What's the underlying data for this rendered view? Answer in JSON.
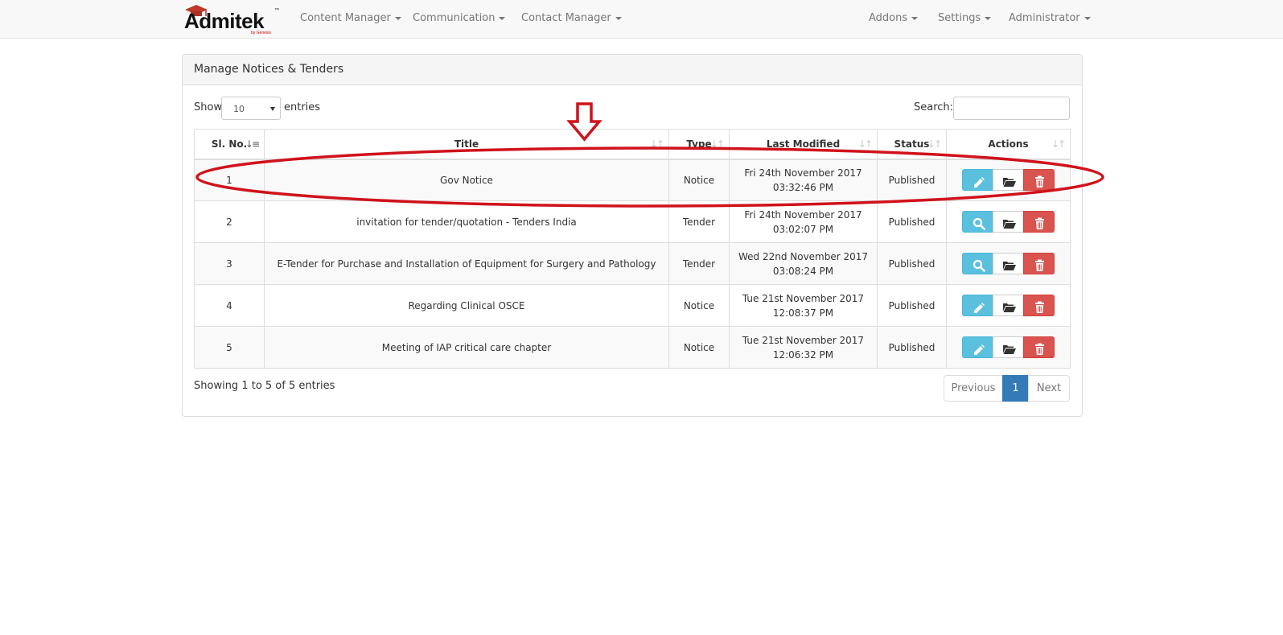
{
  "brand": {
    "name": "Admitek",
    "tm": "™",
    "sub": "by Genesis"
  },
  "nav": {
    "left": [
      "Content Manager",
      "Communication",
      "Contact Manager"
    ],
    "right": [
      "Addons",
      "Settings",
      "Administrator"
    ]
  },
  "panel": {
    "title": "Manage Notices & Tenders"
  },
  "controls": {
    "show_label": "Show",
    "entries_value": "10",
    "entries_label": "entries",
    "search_label": "Search:",
    "search_value": ""
  },
  "table": {
    "columns": [
      "Sl. No.",
      "Title",
      "Type",
      "Last Modified",
      "Status",
      "Actions"
    ],
    "rows": [
      {
        "sl": "1",
        "title": "Gov Notice",
        "type": "Notice",
        "date": "Fri 24th November 2017",
        "time": "03:32:46 PM",
        "status": "Published",
        "first_action": "edit-icon"
      },
      {
        "sl": "2",
        "title": "invitation for tender/quotation - Tenders India",
        "type": "Tender",
        "date": "Fri 24th November 2017",
        "time": "03:02:07 PM",
        "status": "Published",
        "first_action": "search-icon"
      },
      {
        "sl": "3",
        "title": "E-Tender for Purchase and Installation of Equipment for Surgery and Pathology",
        "type": "Tender",
        "date": "Wed 22nd November 2017",
        "time": "03:08:24 PM",
        "status": "Published",
        "first_action": "search-icon"
      },
      {
        "sl": "4",
        "title": "Regarding Clinical OSCE",
        "type": "Notice",
        "date": "Tue 21st November 2017",
        "time": "12:08:37 PM",
        "status": "Published",
        "first_action": "edit-icon"
      },
      {
        "sl": "5",
        "title": "Meeting of IAP critical care chapter",
        "type": "Notice",
        "date": "Tue 21st November 2017",
        "time": "12:06:32 PM",
        "status": "Published",
        "first_action": "edit-icon"
      }
    ]
  },
  "footer": {
    "info": "Showing 1 to 5 of 5 entries"
  },
  "pagination": {
    "previous": "Previous",
    "current": "1",
    "next": "Next"
  },
  "colors": {
    "info": "#5bc0de",
    "danger": "#d9534f",
    "primary": "#337ab7",
    "annotation": "#d0121b"
  }
}
